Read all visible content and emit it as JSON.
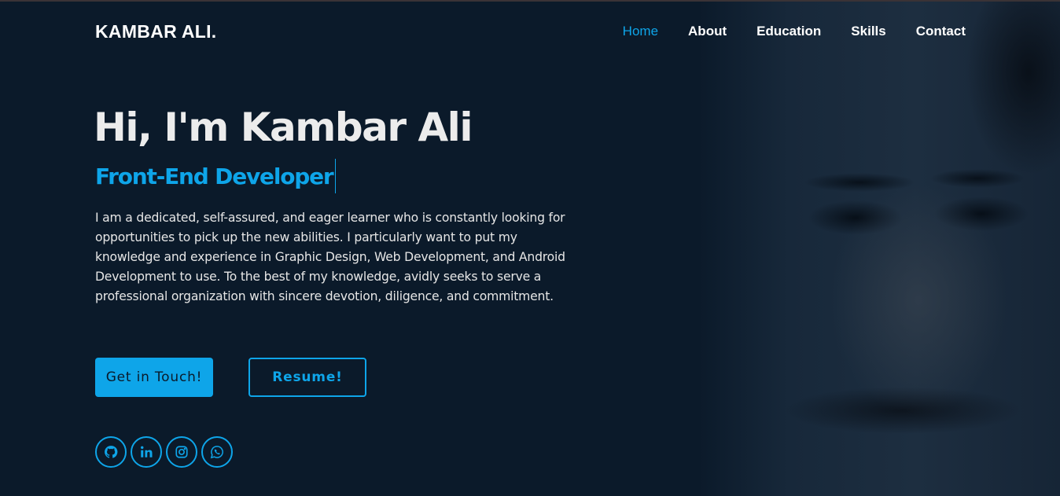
{
  "brand": "KAMBAR ALI.",
  "nav": {
    "items": [
      {
        "label": "Home",
        "active": true
      },
      {
        "label": "About",
        "active": false
      },
      {
        "label": "Education",
        "active": false
      },
      {
        "label": "Skills",
        "active": false
      },
      {
        "label": "Contact",
        "active": false
      }
    ]
  },
  "hero": {
    "title": "Hi, I'm Kambar Ali",
    "role": "Front-End Developer",
    "bio": "I am a dedicated, self-assured, and eager learner who is constantly looking for opportunities to pick up the new abilities. I particularly want to put my knowledge and experience in Graphic Design, Web Development, and Android Development to use. To the best of my knowledge, avidly seeks to serve a professional organization with sincere devotion, diligence, and commitment."
  },
  "buttons": {
    "contact": "Get in Touch!",
    "resume": "Resume!"
  },
  "socials": [
    {
      "icon": "github-icon"
    },
    {
      "icon": "linkedin-icon"
    },
    {
      "icon": "instagram-icon"
    },
    {
      "icon": "whatsapp-icon"
    }
  ],
  "colors": {
    "background": "#0b1a2a",
    "accent": "#0ea5e9",
    "text": "#ffffff"
  }
}
